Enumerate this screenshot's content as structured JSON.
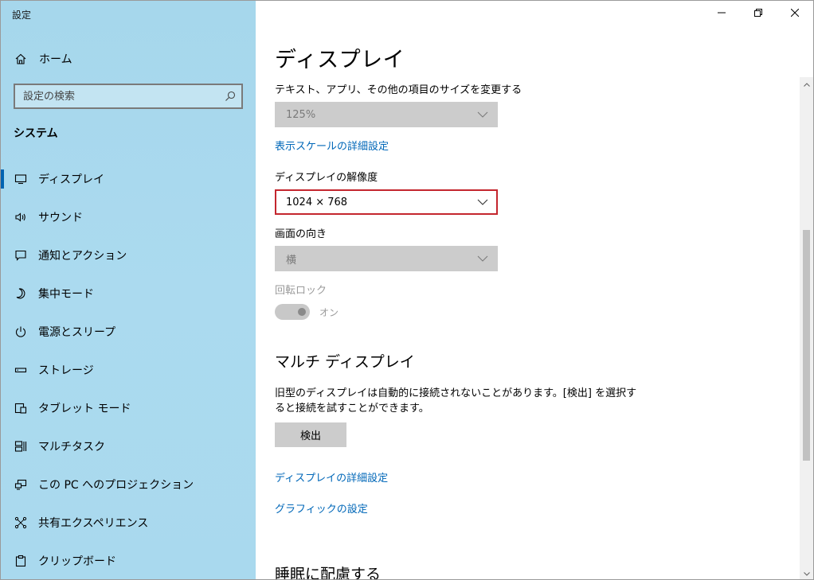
{
  "window": {
    "title": "設定"
  },
  "sidebar": {
    "home_label": "ホーム",
    "search_placeholder": "設定の検索",
    "section_label": "システム",
    "items": [
      {
        "label": "ディスプレイ",
        "icon": "monitor-icon",
        "selected": true
      },
      {
        "label": "サウンド",
        "icon": "speaker-icon"
      },
      {
        "label": "通知とアクション",
        "icon": "notification-icon"
      },
      {
        "label": "集中モード",
        "icon": "moon-icon"
      },
      {
        "label": "電源とスリープ",
        "icon": "power-icon"
      },
      {
        "label": "ストレージ",
        "icon": "storage-icon"
      },
      {
        "label": "タブレット モード",
        "icon": "tablet-icon"
      },
      {
        "label": "マルチタスク",
        "icon": "multitask-icon"
      },
      {
        "label": "この PC へのプロジェクション",
        "icon": "projection-icon"
      },
      {
        "label": "共有エクスペリエンス",
        "icon": "share-icon"
      },
      {
        "label": "クリップボード",
        "icon": "clipboard-icon"
      }
    ]
  },
  "main": {
    "title": "ディスプレイ",
    "scale_label": "テキスト、アプリ、その他の項目のサイズを変更する",
    "scale_value": "125%",
    "advanced_scale_link": "表示スケールの詳細設定",
    "resolution_label": "ディスプレイの解像度",
    "resolution_value": "1024 × 768",
    "orientation_label": "画面の向き",
    "orientation_value": "横",
    "rotation_lock_label": "回転ロック",
    "rotation_lock_state": "オン",
    "multi_display_heading": "マルチ ディスプレイ",
    "multi_display_desc": "旧型のディスプレイは自動的に接続されないことがあります。[検出] を選択すると接続を試すことができます。",
    "detect_button": "検出",
    "advanced_display_link": "ディスプレイの詳細設定",
    "graphics_link": "グラフィックの設定",
    "sleep_heading": "睡眠に配慮する"
  },
  "colors": {
    "accent": "#0063b1",
    "link": "#0067b8",
    "highlight_border": "#c4262e",
    "sidebar_bg": "#a9d9ee"
  }
}
